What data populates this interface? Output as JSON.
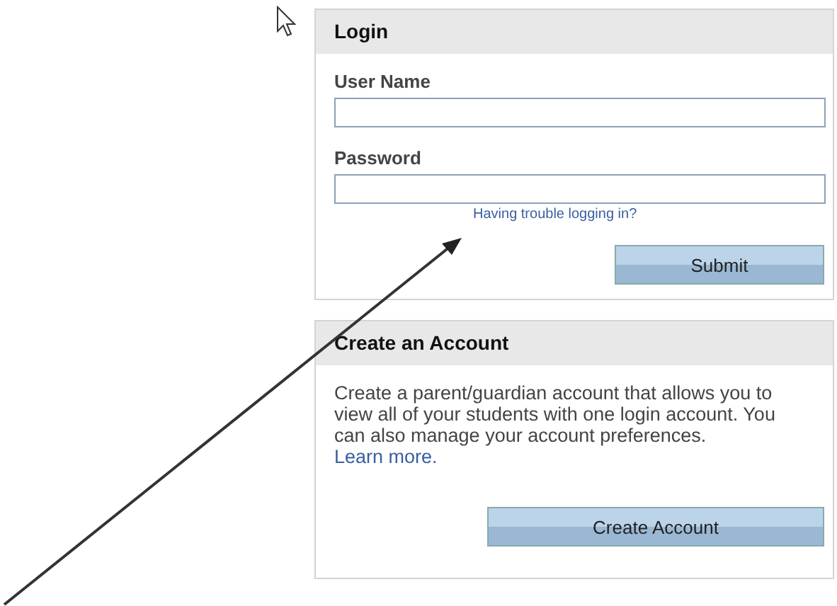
{
  "login": {
    "title": "Login",
    "fields": [
      {
        "label": "User Name"
      },
      {
        "label": "Password"
      }
    ],
    "help_link": "Having trouble logging in?",
    "submit": "Submit"
  },
  "create_account": {
    "title": "Create an Account",
    "description": "Create a parent/guardian account that allows you to view all of your students with one login account. You can also manage your account preferences.",
    "link": "Learn more.",
    "button": "Create Account"
  }
}
